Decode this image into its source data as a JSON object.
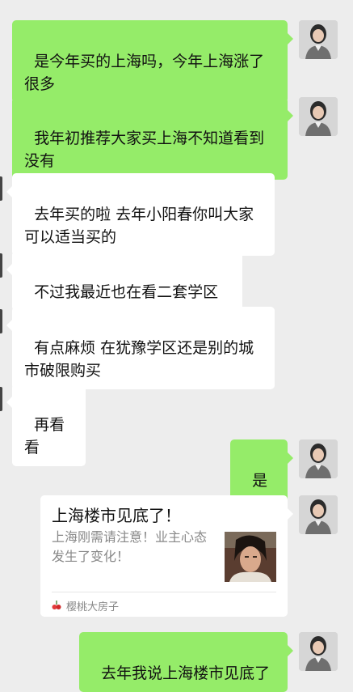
{
  "messages": [
    {
      "side": "me",
      "text": "是今年买的上海吗，今年上海涨了很多"
    },
    {
      "side": "me",
      "text": "我年初推荐大家买上海不知道看到没有"
    },
    {
      "side": "other",
      "text": "去年买的啦 去年小阳春你叫大家可以适当买的"
    },
    {
      "side": "other",
      "text": "不过我最近也在看二套学区"
    },
    {
      "side": "other",
      "text": "有点麻烦 在犹豫学区还是别的城市破限购买"
    },
    {
      "side": "other",
      "text": "再看看"
    },
    {
      "side": "me",
      "text": "是的"
    }
  ],
  "link_card": {
    "title": "上海楼市见底了！",
    "description": "上海刚需请注意！业主心态发生了变化！",
    "source": "樱桃大房子"
  },
  "last_message": {
    "side": "me",
    "text": "去年我说上海楼市见底了"
  },
  "colors": {
    "background": "#ededed",
    "my_bubble": "#95ec69",
    "other_bubble": "#ffffff"
  }
}
